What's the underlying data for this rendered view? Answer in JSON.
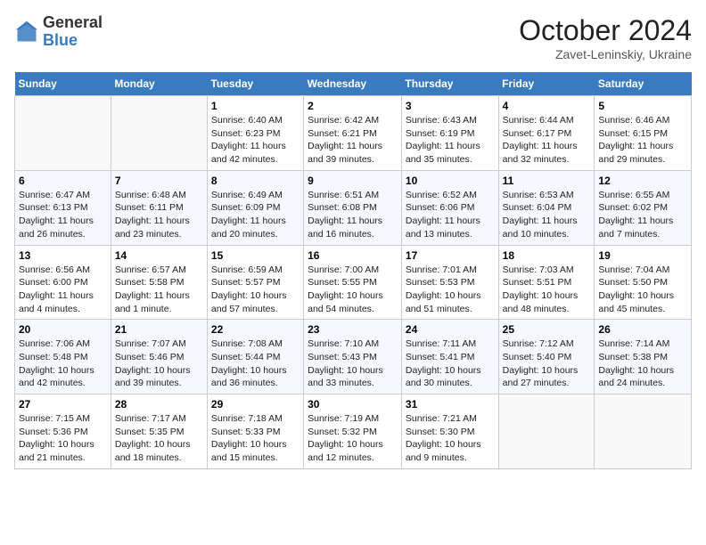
{
  "header": {
    "logo_general": "General",
    "logo_blue": "Blue",
    "month_title": "October 2024",
    "location": "Zavet-Leninskiy, Ukraine"
  },
  "weekdays": [
    "Sunday",
    "Monday",
    "Tuesday",
    "Wednesday",
    "Thursday",
    "Friday",
    "Saturday"
  ],
  "weeks": [
    [
      {
        "day": "",
        "info": ""
      },
      {
        "day": "",
        "info": ""
      },
      {
        "day": "1",
        "info": "Sunrise: 6:40 AM\nSunset: 6:23 PM\nDaylight: 11 hours and 42 minutes."
      },
      {
        "day": "2",
        "info": "Sunrise: 6:42 AM\nSunset: 6:21 PM\nDaylight: 11 hours and 39 minutes."
      },
      {
        "day": "3",
        "info": "Sunrise: 6:43 AM\nSunset: 6:19 PM\nDaylight: 11 hours and 35 minutes."
      },
      {
        "day": "4",
        "info": "Sunrise: 6:44 AM\nSunset: 6:17 PM\nDaylight: 11 hours and 32 minutes."
      },
      {
        "day": "5",
        "info": "Sunrise: 6:46 AM\nSunset: 6:15 PM\nDaylight: 11 hours and 29 minutes."
      }
    ],
    [
      {
        "day": "6",
        "info": "Sunrise: 6:47 AM\nSunset: 6:13 PM\nDaylight: 11 hours and 26 minutes."
      },
      {
        "day": "7",
        "info": "Sunrise: 6:48 AM\nSunset: 6:11 PM\nDaylight: 11 hours and 23 minutes."
      },
      {
        "day": "8",
        "info": "Sunrise: 6:49 AM\nSunset: 6:09 PM\nDaylight: 11 hours and 20 minutes."
      },
      {
        "day": "9",
        "info": "Sunrise: 6:51 AM\nSunset: 6:08 PM\nDaylight: 11 hours and 16 minutes."
      },
      {
        "day": "10",
        "info": "Sunrise: 6:52 AM\nSunset: 6:06 PM\nDaylight: 11 hours and 13 minutes."
      },
      {
        "day": "11",
        "info": "Sunrise: 6:53 AM\nSunset: 6:04 PM\nDaylight: 11 hours and 10 minutes."
      },
      {
        "day": "12",
        "info": "Sunrise: 6:55 AM\nSunset: 6:02 PM\nDaylight: 11 hours and 7 minutes."
      }
    ],
    [
      {
        "day": "13",
        "info": "Sunrise: 6:56 AM\nSunset: 6:00 PM\nDaylight: 11 hours and 4 minutes."
      },
      {
        "day": "14",
        "info": "Sunrise: 6:57 AM\nSunset: 5:58 PM\nDaylight: 11 hours and 1 minute."
      },
      {
        "day": "15",
        "info": "Sunrise: 6:59 AM\nSunset: 5:57 PM\nDaylight: 10 hours and 57 minutes."
      },
      {
        "day": "16",
        "info": "Sunrise: 7:00 AM\nSunset: 5:55 PM\nDaylight: 10 hours and 54 minutes."
      },
      {
        "day": "17",
        "info": "Sunrise: 7:01 AM\nSunset: 5:53 PM\nDaylight: 10 hours and 51 minutes."
      },
      {
        "day": "18",
        "info": "Sunrise: 7:03 AM\nSunset: 5:51 PM\nDaylight: 10 hours and 48 minutes."
      },
      {
        "day": "19",
        "info": "Sunrise: 7:04 AM\nSunset: 5:50 PM\nDaylight: 10 hours and 45 minutes."
      }
    ],
    [
      {
        "day": "20",
        "info": "Sunrise: 7:06 AM\nSunset: 5:48 PM\nDaylight: 10 hours and 42 minutes."
      },
      {
        "day": "21",
        "info": "Sunrise: 7:07 AM\nSunset: 5:46 PM\nDaylight: 10 hours and 39 minutes."
      },
      {
        "day": "22",
        "info": "Sunrise: 7:08 AM\nSunset: 5:44 PM\nDaylight: 10 hours and 36 minutes."
      },
      {
        "day": "23",
        "info": "Sunrise: 7:10 AM\nSunset: 5:43 PM\nDaylight: 10 hours and 33 minutes."
      },
      {
        "day": "24",
        "info": "Sunrise: 7:11 AM\nSunset: 5:41 PM\nDaylight: 10 hours and 30 minutes."
      },
      {
        "day": "25",
        "info": "Sunrise: 7:12 AM\nSunset: 5:40 PM\nDaylight: 10 hours and 27 minutes."
      },
      {
        "day": "26",
        "info": "Sunrise: 7:14 AM\nSunset: 5:38 PM\nDaylight: 10 hours and 24 minutes."
      }
    ],
    [
      {
        "day": "27",
        "info": "Sunrise: 7:15 AM\nSunset: 5:36 PM\nDaylight: 10 hours and 21 minutes."
      },
      {
        "day": "28",
        "info": "Sunrise: 7:17 AM\nSunset: 5:35 PM\nDaylight: 10 hours and 18 minutes."
      },
      {
        "day": "29",
        "info": "Sunrise: 7:18 AM\nSunset: 5:33 PM\nDaylight: 10 hours and 15 minutes."
      },
      {
        "day": "30",
        "info": "Sunrise: 7:19 AM\nSunset: 5:32 PM\nDaylight: 10 hours and 12 minutes."
      },
      {
        "day": "31",
        "info": "Sunrise: 7:21 AM\nSunset: 5:30 PM\nDaylight: 10 hours and 9 minutes."
      },
      {
        "day": "",
        "info": ""
      },
      {
        "day": "",
        "info": ""
      }
    ]
  ]
}
